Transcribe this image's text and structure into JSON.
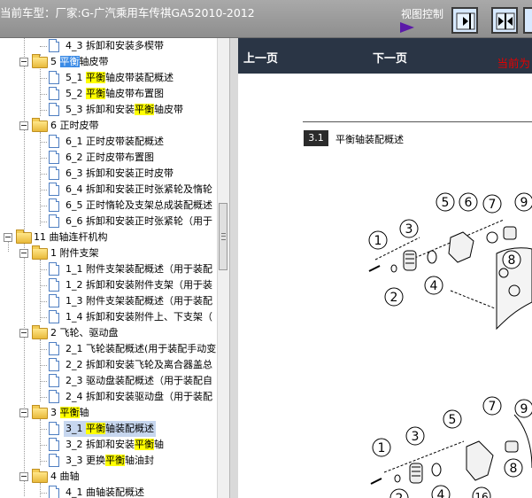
{
  "header": {
    "car_model": "当前车型：厂家:G-广汽乘用车传祺GA52010-2012",
    "view_control": "视图控制"
  },
  "tree": {
    "rows": [
      {
        "label": "4_3 拆卸和安装多楔带"
      },
      {
        "prefix": "5 ",
        "hl": "平衡",
        "rest": "轴皮带"
      },
      {
        "prefix": "5_1 ",
        "hl": "平衡",
        "rest": "轴皮带装配概述"
      },
      {
        "prefix": "5_2 ",
        "hl": "平衡",
        "rest": "轴皮带布置图"
      },
      {
        "prefix": "5_3 拆卸和安装",
        "hl": "平衡",
        "rest": "轴皮带"
      },
      {
        "label": "6 正时皮带"
      },
      {
        "label": "6_1 正时皮带装配概述"
      },
      {
        "label": "6_2 正时皮带布置图"
      },
      {
        "label": "6_3 拆卸和安装正时皮带"
      },
      {
        "label": "6_4 拆卸和安装正时张紧轮及惰轮"
      },
      {
        "label": "6_5 正时惰轮及支架总成装配概述"
      },
      {
        "label": "6_6 拆卸和安装正时张紧轮（用于"
      },
      {
        "label": "11 曲轴连杆机构"
      },
      {
        "label": "1 附件支架"
      },
      {
        "label": "1_1 附件支架装配概述（用于装配"
      },
      {
        "label": "1_2 拆卸和安装附件支架（用于装"
      },
      {
        "label": "1_3 附件支架装配概述（用于装配"
      },
      {
        "label": "1_4 拆卸和安装附件上、下支架（"
      },
      {
        "label": "2 飞轮、驱动盘"
      },
      {
        "label": "2_1 飞轮装配概述(用于装配手动变"
      },
      {
        "label": "2_2 拆卸和安装飞轮及离合器盖总"
      },
      {
        "label": "2_3 驱动盘装配概述（用于装配自"
      },
      {
        "label": "2_4 拆卸和安装驱动盘（用于装配"
      },
      {
        "prefix": "3 ",
        "hl": "平衡",
        "rest": "轴"
      },
      {
        "prefix": "3_1 ",
        "hl": "平衡",
        "rest": "轴装配概述"
      },
      {
        "prefix": "3_2 拆卸和安装",
        "hl": "平衡",
        "rest": "轴"
      },
      {
        "prefix": "3_3 更换",
        "hl": "平衡",
        "rest": "轴油封"
      },
      {
        "label": "4 曲轴"
      },
      {
        "label": "4_1 曲轴装配概述"
      }
    ]
  },
  "content": {
    "prev": "上一页",
    "next": "下一页",
    "current": "当前为",
    "section_number": "3.1",
    "section_title": "平衡轴装配概述",
    "callouts": [
      "1",
      "2",
      "3",
      "4",
      "5",
      "6",
      "7",
      "8",
      "9",
      "1",
      "2",
      "3",
      "4",
      "5",
      "7",
      "8",
      "9",
      "16"
    ]
  }
}
